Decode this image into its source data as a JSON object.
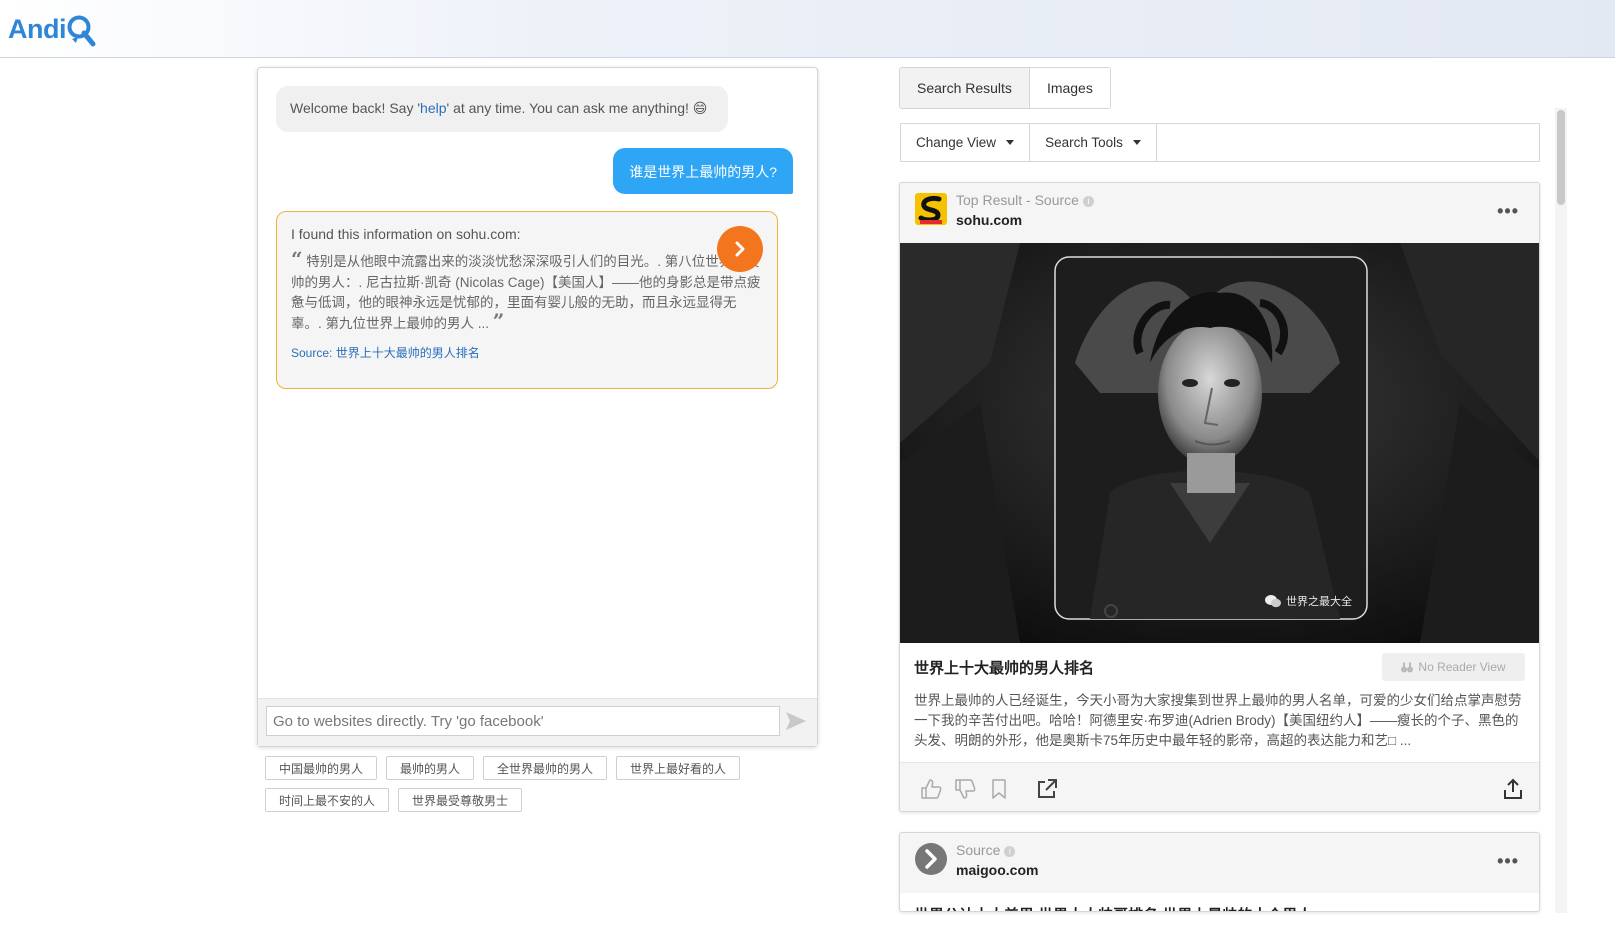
{
  "app": {
    "logo_text": "Andi"
  },
  "chat": {
    "welcome_prefix": "Welcome back! Say '",
    "welcome_help": "help",
    "welcome_suffix": "' at any time. You can ask me anything! 😄",
    "user_message": "谁是世界上最帅的男人?",
    "info_intro": "I found this information on sohu.com:",
    "info_quote": "特别是从他眼中流露出来的淡淡忧愁深深吸引人们的目光。. 第八位世界上最帅的男人：. 尼古拉斯·凯奇 (Nicolas Cage)【美国人】——他的身影总是带点疲惫与低调，他的眼神永远是忧郁的，里面有婴儿般的无助，而且永远显得无辜。. 第九位世界上最帅的男人 ...",
    "info_source": "Source: 世界上十大最帅的男人排名",
    "input_placeholder": "Go to websites directly. Try 'go facebook'",
    "suggestions": [
      "中国最帅的男人",
      "最帅的男人",
      "全世界最帅的男人",
      "世界上最好看的人",
      "时间上最不安的人",
      "世界最受尊敬男士"
    ]
  },
  "results": {
    "tabs": [
      "Search Results",
      "Images"
    ],
    "tools": [
      "Change View",
      "Search Tools"
    ],
    "top_card": {
      "label": "Top Result - Source",
      "domain": "sohu.com",
      "title": "世界上十大最帅的男人排名",
      "no_reader": "No Reader View",
      "snippet": "世界上最帅的人已经诞生，今天小哥为大家搜集到世界上最帅的男人名单，可爱的少女们给点掌声慰劳一下我的辛苦付出吧。哈哈！阿德里安·布罗迪(Adrien Brody)【美国纽约人】——瘦长的个子、黑色的头发、明朗的外形，他是奥斯卡75年历史中最年轻的影帝，高超的表达能力和艺□ ...",
      "watermark": "世界之最大全"
    },
    "second_card": {
      "label": "Source",
      "domain": "maigoo.com",
      "title": "世界公认十大美男 世界十大帅哥排名 世界上最帅的十个男人"
    }
  },
  "colors": {
    "accent_blue": "#2ea6f5",
    "orange": "#f3761f",
    "card_border": "#f0b23c"
  }
}
